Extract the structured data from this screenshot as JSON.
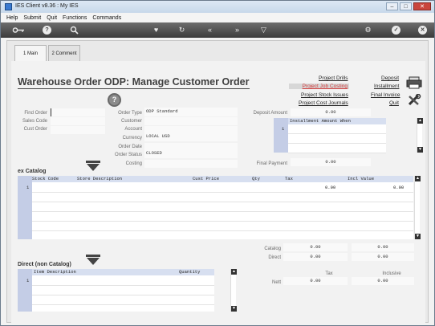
{
  "window": {
    "title": "IES Client v8.36 : My IES"
  },
  "menu": [
    "Help",
    "Submit",
    "Quit",
    "Functions",
    "Commands"
  ],
  "tabs": [
    {
      "label": "1 Main"
    },
    {
      "label": "2 Comment"
    }
  ],
  "page_title": "Warehouse Order ODP: Manage Customer Order",
  "links": {
    "project_drills": "Project Drills",
    "project_job_costing": "Project Job Costing",
    "project_stock_issues": "Project Stock Issues",
    "project_cost_journals": "Project Cost Journals",
    "deposit": "Deposit",
    "installment": "Installment",
    "final_invoice": "Final Invoice",
    "quit": "Quit"
  },
  "left_fields": {
    "find_order": "Find Order",
    "sales_code": "Sales Code",
    "cust_order": "Cust Order"
  },
  "order_fields": {
    "order_type_label": "Order Type",
    "order_type_value": "ODP Standard",
    "customer_label": "Customer",
    "account_label": "Account",
    "currency_label": "Currency",
    "currency_value": "LOCAL USD",
    "order_date_label": "Order Date",
    "order_status_label": "Order Status",
    "order_status_value": "CLOSED",
    "costing_label": "Costing"
  },
  "deposit": {
    "deposit_amount_label": "Deposit Amount",
    "deposit_amount_value": "0.00",
    "installment_header": "Installment Amount When",
    "installment_row_num": "1",
    "final_payment_label": "Final Payment",
    "final_payment_value": "0.00"
  },
  "catalog": {
    "section_title": "ex Catalog",
    "columns": {
      "stock_code": "Stock Code",
      "store_description": "Store Description",
      "cust_price": "Cust Price",
      "qty": "Qty",
      "tax": "Tax",
      "incl_value": "Incl Value"
    },
    "row1": {
      "num": "1",
      "tax": "0.00",
      "incl_value": "0.00"
    },
    "totals": {
      "catalog_label": "Catalog",
      "catalog_tax": "0.00",
      "catalog_incl": "0.00",
      "direct_label": "Direct",
      "direct_tax": "0.00",
      "direct_incl": "0.00"
    }
  },
  "direct": {
    "section_title": "Direct (non Catalog)",
    "columns": {
      "item_description": "Item Description",
      "quantity": "Quantity"
    },
    "row1": {
      "num": "1"
    },
    "totals": {
      "tax_label": "Tax",
      "inclusive_label": "Inclusive",
      "nett_label": "Nett",
      "nett_tax": "0.00",
      "nett_incl": "0.00"
    }
  },
  "colors": {
    "grid_header": "#d7dff0",
    "grid_side": "#c4cde6",
    "toolbar": "#4a4a4a",
    "link_highlight": "#d13a3a"
  },
  "icons": [
    "key-icon",
    "help-icon",
    "search-icon",
    "heart-icon",
    "refresh-icon",
    "rewind-icon",
    "fast-forward-icon",
    "filter-icon",
    "settings-icon",
    "check-icon",
    "close-icon",
    "printer-icon",
    "tools-icon"
  ]
}
